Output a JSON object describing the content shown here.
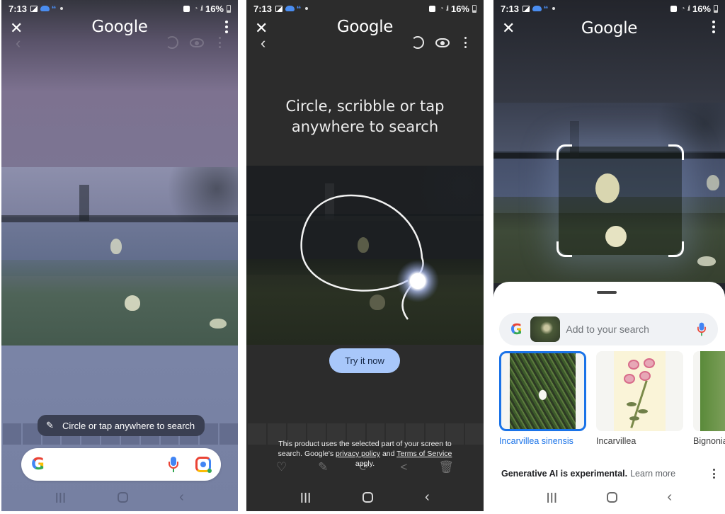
{
  "status_bar": {
    "time": "7:13",
    "battery": "16%"
  },
  "app_title": "Google",
  "panel1": {
    "hint_chip": "Circle or tap anywhere to search",
    "search_bar": {
      "logo": "G",
      "icons": [
        "mic-icon",
        "lens-icon"
      ]
    }
  },
  "panel2": {
    "instruction_line1": "Circle, scribble or tap",
    "instruction_line2": "anywhere to search",
    "try_button": "Try it now",
    "legal": {
      "prefix": "This product uses the selected part of your screen to search. Google's ",
      "privacy_link": "privacy policy",
      "middle": " and ",
      "terms_link": "Terms of Service",
      "suffix": " apply."
    },
    "gallery_actions": [
      "heart-icon",
      "pencil-icon",
      "sync-icon",
      "share-icon",
      "trash-icon"
    ]
  },
  "panel3": {
    "search_placeholder": "Add to your search",
    "results": [
      {
        "label": "Incarvillea sinensis",
        "selected": true
      },
      {
        "label": "Incarvillea",
        "selected": false
      },
      {
        "label": "Bignonia",
        "selected": false
      }
    ],
    "gen_ai_notice": "Generative AI is experimental.",
    "learn_more": "Learn more"
  },
  "nav": {
    "recents": "|||",
    "back": "‹"
  },
  "colors": {
    "accent_blue": "#1a73e8",
    "try_button_bg": "#a8c7fa",
    "google_red": "#ea4335",
    "google_yellow": "#fbbc05",
    "google_green": "#34a853",
    "google_blue": "#4285f4"
  }
}
